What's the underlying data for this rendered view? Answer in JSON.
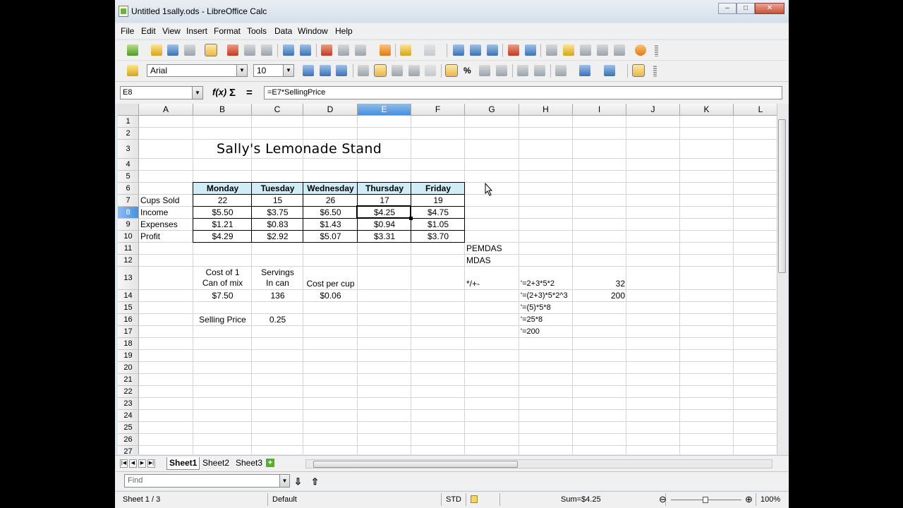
{
  "window": {
    "title": "Untitled 1sally.ods - LibreOffice Calc",
    "minimize": "–",
    "maximize": "□",
    "close": "✕"
  },
  "menu": [
    "File",
    "Edit",
    "View",
    "Insert",
    "Format",
    "Tools",
    "Data",
    "Window",
    "Help"
  ],
  "toolbar2": {
    "font_name": "Arial",
    "font_size": "10",
    "percent_label": "%"
  },
  "formula_bar": {
    "cell_ref": "E8",
    "fx": "f(x)",
    "sum": "Σ",
    "equals": "=",
    "formula": "=E7*SellingPrice"
  },
  "columns": [
    "A",
    "B",
    "C",
    "D",
    "E",
    "F",
    "G",
    "H",
    "I",
    "J",
    "K",
    "L"
  ],
  "active_column": "E",
  "rows": [
    "1",
    "2",
    "3",
    "4",
    "5",
    "6",
    "7",
    "8",
    "9",
    "10",
    "11",
    "12",
    "13",
    "14",
    "15",
    "16",
    "17",
    "18",
    "19",
    "20",
    "21",
    "22",
    "23",
    "24",
    "25",
    "26",
    "27"
  ],
  "active_row": "8",
  "sheet": {
    "title": "Sally's Lemonade Stand",
    "days": [
      "Monday",
      "Tuesday",
      "Wednesday",
      "Thursday",
      "Friday"
    ],
    "data_rows": [
      {
        "label": "Cups Sold",
        "values": [
          "22",
          "15",
          "26",
          "17",
          "19"
        ]
      },
      {
        "label": "Income",
        "values": [
          "$5.50",
          "$3.75",
          "$6.50",
          "$4.25",
          "$4.75"
        ]
      },
      {
        "label": "Expenses",
        "values": [
          "$1.21",
          "$0.83",
          "$1.43",
          "$0.94",
          "$1.05"
        ]
      },
      {
        "label": "Profit",
        "values": [
          "$4.29",
          "$2.92",
          "$5.07",
          "$3.31",
          "$3.70"
        ]
      }
    ],
    "pemdas": "PEMDAS",
    "mdas": "MDAS",
    "ops": "*/+-",
    "cost_label_1": "Cost of 1",
    "cost_label_2": "Can of mix",
    "servings_1": "Servings",
    "servings_2": "In can",
    "cost_per_cup": "Cost per cup",
    "cost_value": "$7.50",
    "servings_value": "136",
    "cost_per_cup_value": "$0.06",
    "selling_price_label": "Selling Price",
    "selling_price_value": "0.25",
    "formulas": [
      "'=2+3*5*2",
      "'=(2+3)*5*2^3",
      "'=(5)*5*8",
      "'=25*8",
      "'=200"
    ],
    "formula_results": [
      "32",
      "200"
    ]
  },
  "tabs": [
    "Sheet1",
    "Sheet2",
    "Sheet3"
  ],
  "active_tab": "Sheet1",
  "find": {
    "placeholder": "Find"
  },
  "status": {
    "sheet": "Sheet 1 / 3",
    "style": "Default",
    "mode": "STD",
    "sum": "Sum=$4.25",
    "zoom": "100%"
  },
  "colors": {
    "header_fill": "#cfecf7",
    "active_header": "#4a8fdc",
    "accent": "#6cb33e"
  },
  "icons": [
    "new-icon",
    "open-icon",
    "save-icon",
    "email-icon",
    "edit-file-icon",
    "pdf-icon",
    "print-icon",
    "print-preview-icon",
    "spellcheck-icon",
    "autospell-icon",
    "cut-icon",
    "copy-icon",
    "paste-icon",
    "clone-format-icon",
    "undo-icon",
    "redo-icon",
    "hyperlink-icon",
    "sort-ascending-icon",
    "sort-descending-icon",
    "chart-icon",
    "pivot-icon",
    "show-draw-icon",
    "navigator-icon",
    "gallery-icon",
    "data-sources-icon",
    "zoom-icon",
    "help-icon"
  ]
}
